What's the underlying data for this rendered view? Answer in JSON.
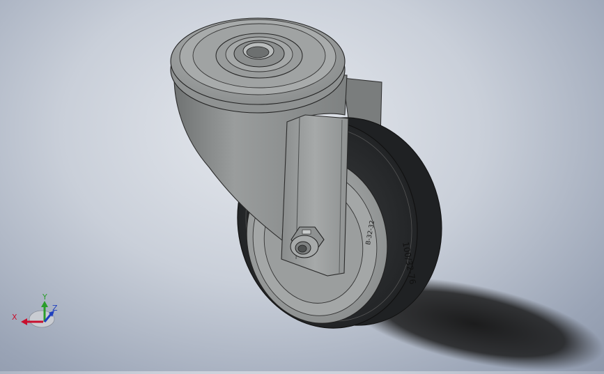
{
  "viewport": {
    "background_top": "#e6e9ee",
    "background_bottom": "#8e98ab"
  },
  "model": {
    "name_icon": "caster-wheel-model",
    "tire_marking": "100/32-76",
    "rim_marking": "B-32-32",
    "colors": {
      "housing": "#8e9191",
      "plate": "#a2a5a5",
      "tire": "#2e3032",
      "rim": "#9a9d9d",
      "shadow": "#1a1a1a"
    }
  },
  "triad": {
    "x_label": "X",
    "y_label": "Y",
    "z_label": "Z",
    "x_color": "#c8102e",
    "y_color": "#2a9d2a",
    "z_color": "#1f3fbf"
  }
}
